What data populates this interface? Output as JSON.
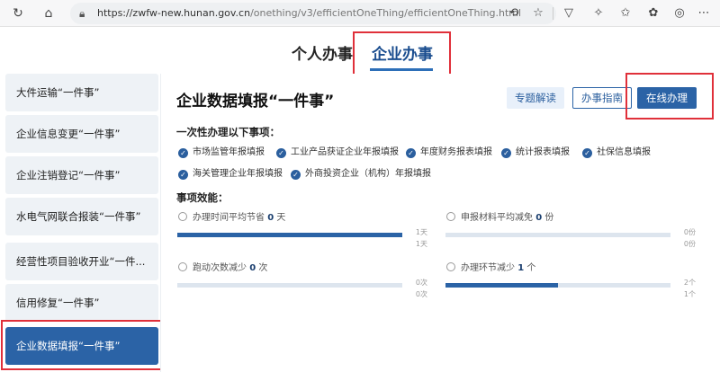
{
  "browser": {
    "url_prefix": "https://zwfw-new.hunan.gov.cn",
    "url_path": "/onething/v3/efficientOneThing/efficientOneThing.html"
  },
  "tabs": [
    {
      "label": "个人办事"
    },
    {
      "label": "企业办事"
    }
  ],
  "sidebar": {
    "items": [
      {
        "label": "大件运输“一件事”"
      },
      {
        "label": "企业信息变更“一件事”"
      },
      {
        "label": "企业注销登记“一件事”"
      },
      {
        "label": "水电气网联合报装“一件事”"
      },
      {
        "label": "经营性项目验收开业“一件..."
      },
      {
        "label": "信用修复“一件事”"
      },
      {
        "label": "企业数据填报“一件事”"
      }
    ]
  },
  "panel": {
    "title": "企业数据填报“一件事”",
    "buttons": {
      "topic": "专题解读",
      "guide": "办事指南",
      "online": "在线办理"
    },
    "onetime_label": "一次性办理以下事项：",
    "items": [
      "市场监管年报填报",
      "工业产品获证企业年报填报",
      "年度财务报表填报",
      "统计报表填报",
      "社保信息填报",
      "海关管理企业年报填报",
      "外商投资企业（机构）年报填报"
    ],
    "efficiency_label": "事项效能：",
    "metrics": [
      {
        "prefix": "办理时间平均节省",
        "value": "0",
        "unit": "天",
        "top_text": "1天",
        "bottom_text": "1天",
        "fill": 1.0
      },
      {
        "prefix": "申报材料平均减免",
        "value": "0",
        "unit": "份",
        "top_text": "0份",
        "bottom_text": "0份",
        "fill": 0.0
      },
      {
        "prefix": "跑动次数减少",
        "value": "0",
        "unit": "次",
        "top_text": "0次",
        "bottom_text": "0次",
        "fill": 0.0
      },
      {
        "prefix": "办理环节减少",
        "value": "1",
        "unit": "个",
        "top_text": "2个",
        "bottom_text": "1个",
        "fill": 0.5
      }
    ]
  }
}
